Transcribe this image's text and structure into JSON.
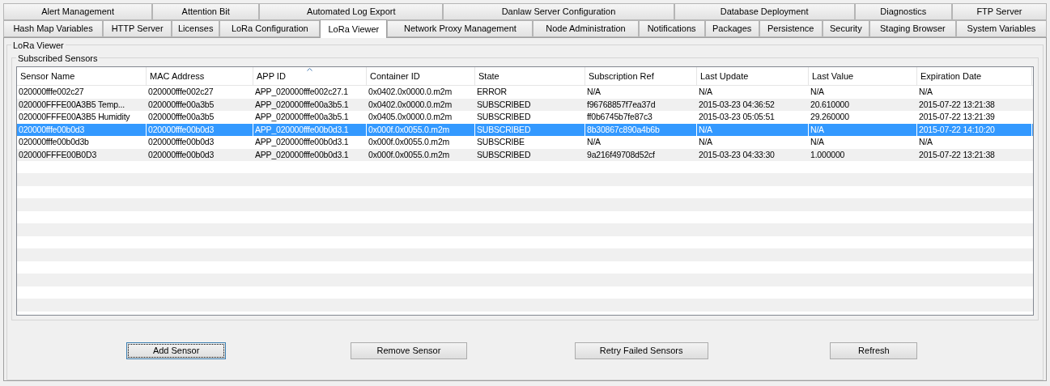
{
  "tab_rows": [
    [
      {
        "label": "Alert Management",
        "selected": false
      },
      {
        "label": "Attention Bit",
        "selected": false
      },
      {
        "label": "Automated Log Export",
        "selected": false
      },
      {
        "label": "Danlaw Server Configuration",
        "selected": false
      },
      {
        "label": "Database Deployment",
        "selected": false
      },
      {
        "label": "Diagnostics",
        "selected": false
      },
      {
        "label": "FTP Server",
        "selected": false
      }
    ],
    [
      {
        "label": "Hash Map Variables",
        "selected": false
      },
      {
        "label": "HTTP Server",
        "selected": false
      },
      {
        "label": "Licenses",
        "selected": false
      },
      {
        "label": "LoRa Configuration",
        "selected": false
      },
      {
        "label": "LoRa Viewer",
        "selected": true
      },
      {
        "label": "Network Proxy Management",
        "selected": false
      },
      {
        "label": "Node Administration",
        "selected": false
      },
      {
        "label": "Notifications",
        "selected": false
      },
      {
        "label": "Packages",
        "selected": false
      },
      {
        "label": "Persistence",
        "selected": false
      },
      {
        "label": "Security",
        "selected": false
      },
      {
        "label": "Staging Browser",
        "selected": false
      },
      {
        "label": "System Variables",
        "selected": false
      }
    ]
  ],
  "panel": {
    "title": "LoRa Viewer",
    "group_title": "Subscribed Sensors"
  },
  "table": {
    "columns": [
      {
        "label": "Sensor Name",
        "sorted": false
      },
      {
        "label": "MAC Address",
        "sorted": false
      },
      {
        "label": "APP ID",
        "sorted": true
      },
      {
        "label": "Container ID",
        "sorted": false
      },
      {
        "label": "State",
        "sorted": false
      },
      {
        "label": "Subscription Ref",
        "sorted": false
      },
      {
        "label": "Last Update",
        "sorted": false
      },
      {
        "label": "Last Value",
        "sorted": false
      },
      {
        "label": "Expiration Date",
        "sorted": false
      }
    ],
    "rows": [
      {
        "selected": false,
        "cells": [
          "020000fffe002c27",
          "020000fffe002c27",
          "APP_020000fffe002c27.1",
          "0x0402.0x0000.0.m2m",
          "ERROR",
          "N/A",
          "N/A",
          "N/A",
          "N/A"
        ]
      },
      {
        "selected": false,
        "cells": [
          "020000FFFE00A3B5 Temp...",
          "020000fffe00a3b5",
          "APP_020000fffe00a3b5.1",
          "0x0402.0x0000.0.m2m",
          "SUBSCRIBED",
          "f96768857f7ea37d",
          "2015-03-23 04:36:52",
          "20.610000",
          "2015-07-22 13:21:38"
        ]
      },
      {
        "selected": false,
        "cells": [
          "020000FFFE00A3B5 Humidity",
          "020000fffe00a3b5",
          "APP_020000fffe00a3b5.1",
          "0x0405.0x0000.0.m2m",
          "SUBSCRIBED",
          "ff0b6745b7fe87c3",
          "2015-03-23 05:05:51",
          "29.260000",
          "2015-07-22 13:21:39"
        ]
      },
      {
        "selected": true,
        "cells": [
          "020000fffe00b0d3",
          "020000fffe00b0d3",
          "APP_020000fffe00b0d3.1",
          "0x000f.0x0055.0.m2m",
          "SUBSCRIBED",
          "8b30867c890a4b6b",
          "N/A",
          "N/A",
          "2015-07-22 14:10:20"
        ]
      },
      {
        "selected": false,
        "cells": [
          "020000fffe00b0d3b",
          "020000fffe00b0d3",
          "APP_020000fffe00b0d3.1",
          "0x000f.0x0055.0.m2m",
          "SUBSCRIBE",
          "N/A",
          "N/A",
          "N/A",
          "N/A"
        ]
      },
      {
        "selected": false,
        "cells": [
          "020000FFFE00B0D3",
          "020000fffe00b0d3",
          "APP_020000fffe00b0d3.1",
          "0x000f.0x0055.0.m2m",
          "SUBSCRIBED",
          "9a216f49708d52cf",
          "2015-03-23 04:33:30",
          "1.000000",
          "2015-07-22 13:21:38"
        ]
      }
    ]
  },
  "buttons": [
    {
      "label": "Add Sensor",
      "focused": true
    },
    {
      "label": "Remove Sensor",
      "focused": false
    },
    {
      "label": "Retry Failed Sensors",
      "focused": false
    },
    {
      "label": "Refresh",
      "focused": false
    }
  ]
}
